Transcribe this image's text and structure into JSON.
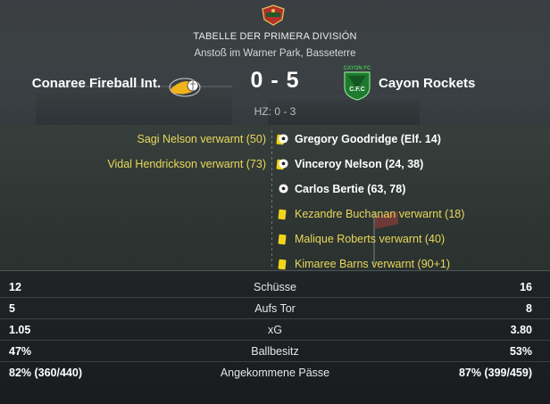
{
  "header": {
    "title": "TABELLE DER PRIMERA DIVISIÓN",
    "venue": "Anstoß im Warner Park, Basseterre",
    "score": "0 - 5",
    "half_time": "HZ: 0 - 3"
  },
  "home": {
    "name": "Conaree Fireball Int.",
    "crest_icon": "conaree-crest-icon"
  },
  "away": {
    "name": "Cayon Rockets",
    "crest_icon": "cayon-crest-icon",
    "crest_text_top": "CAYON FC",
    "crest_text_mid": "C.F.C"
  },
  "home_events": [
    {
      "text": "Sagi Nelson verwarnt (50)",
      "type": "yellow-card"
    },
    {
      "text": "Vidal Hendrickson verwarnt (73)",
      "type": "yellow-card"
    }
  ],
  "away_events": [
    {
      "text": "Gregory Goodridge (Elf. 14)",
      "type": "goal"
    },
    {
      "text": "Vinceroy Nelson (24, 38)",
      "type": "goal"
    },
    {
      "text": "Carlos Bertie (63, 78)",
      "type": "goal"
    },
    {
      "text": "Kezandre Buchanan verwarnt (18)",
      "type": "yellow-card"
    },
    {
      "text": "Malique Roberts verwarnt (40)",
      "type": "yellow-card"
    },
    {
      "text": "Kimaree Barns verwarnt (90+1)",
      "type": "yellow-card"
    }
  ],
  "stats": [
    {
      "home": "12",
      "label": "Schüsse",
      "away": "16"
    },
    {
      "home": "5",
      "label": "Aufs Tor",
      "away": "8"
    },
    {
      "home": "1.05",
      "label": "xG",
      "away": "3.80"
    },
    {
      "home": "47%",
      "label": "Ballbesitz",
      "away": "53%"
    },
    {
      "home": "82% (360/440)",
      "label": "Angekommene Pässe",
      "away": "87% (399/459)"
    }
  ],
  "colors": {
    "yellow_card": "#f1d51b",
    "event_text": "#e9d85a"
  }
}
